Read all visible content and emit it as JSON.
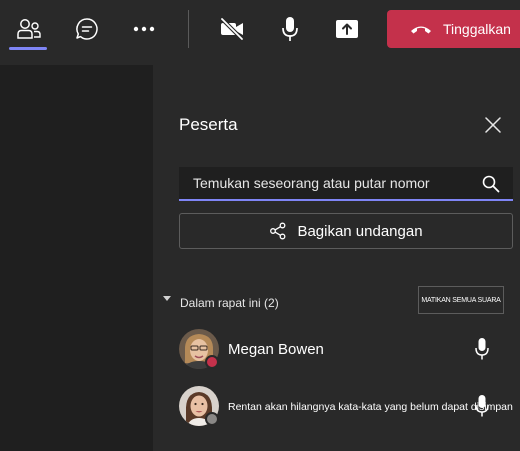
{
  "toolbar": {
    "icons": [
      "people-icon",
      "chat-icon",
      "more-icon",
      "camera-off-icon",
      "microphone-icon",
      "share-tray-icon",
      "hang-up-icon"
    ],
    "leave_label": "Tinggalkan",
    "accent_color": "#7f85f5",
    "leave_color": "#c4314b"
  },
  "panel": {
    "title": "Peserta",
    "search_placeholder": "Temukan seseorang atau putar nomor",
    "invite_label": "Bagikan undangan",
    "section_label": "Dalam rapat ini (2)",
    "mute_all_label": "MATIKAN SEMUA SUARA"
  },
  "participants": [
    {
      "name": "Megan Bowen",
      "status": "busy",
      "status_color": "#c4314b"
    },
    {
      "name": "Rentan akan hilangnya kata-kata yang belum dapat disimpan",
      "status": "offline",
      "status_color": "#8a8886"
    }
  ]
}
